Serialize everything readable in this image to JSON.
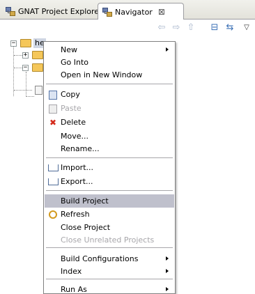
{
  "tabs": [
    {
      "label": "GNAT Project Explorer",
      "active": false,
      "icon": "navigator-icon"
    },
    {
      "label": "Navigator",
      "active": true,
      "icon": "navigator-icon",
      "close": "⊠"
    }
  ],
  "toolbar": {
    "buttons": [
      "back-arrow-icon",
      "forward-arrow-icon",
      "up-folder-icon",
      "collapse-all-icon",
      "link-with-editor-icon",
      "view-menu-icon"
    ]
  },
  "tree": {
    "project_label": "he"
  },
  "context_menu": {
    "items": [
      {
        "label": "New",
        "submenu": true
      },
      {
        "label": "Go Into"
      },
      {
        "label": "Open in New Window"
      },
      {
        "label": "Copy",
        "icon": "copy-icon"
      },
      {
        "label": "Paste",
        "icon": "paste-icon",
        "disabled": true
      },
      {
        "label": "Delete",
        "icon": "delete-icon"
      },
      {
        "label": "Move..."
      },
      {
        "label": "Rename..."
      },
      {
        "label": "Import...",
        "icon": "import-icon"
      },
      {
        "label": "Export...",
        "icon": "export-icon"
      },
      {
        "label": "Build Project",
        "highlighted": true
      },
      {
        "label": "Refresh",
        "icon": "refresh-icon"
      },
      {
        "label": "Close Project"
      },
      {
        "label": "Close Unrelated Projects",
        "disabled": true
      },
      {
        "label": "Build Configurations",
        "submenu": true
      },
      {
        "label": "Index",
        "submenu": true
      },
      {
        "label": "Run As",
        "submenu": true
      }
    ]
  },
  "colors": {
    "highlight": "#bfc0cc",
    "disabled_text": "#a7a6aa",
    "delete_red": "#d42a1b"
  }
}
